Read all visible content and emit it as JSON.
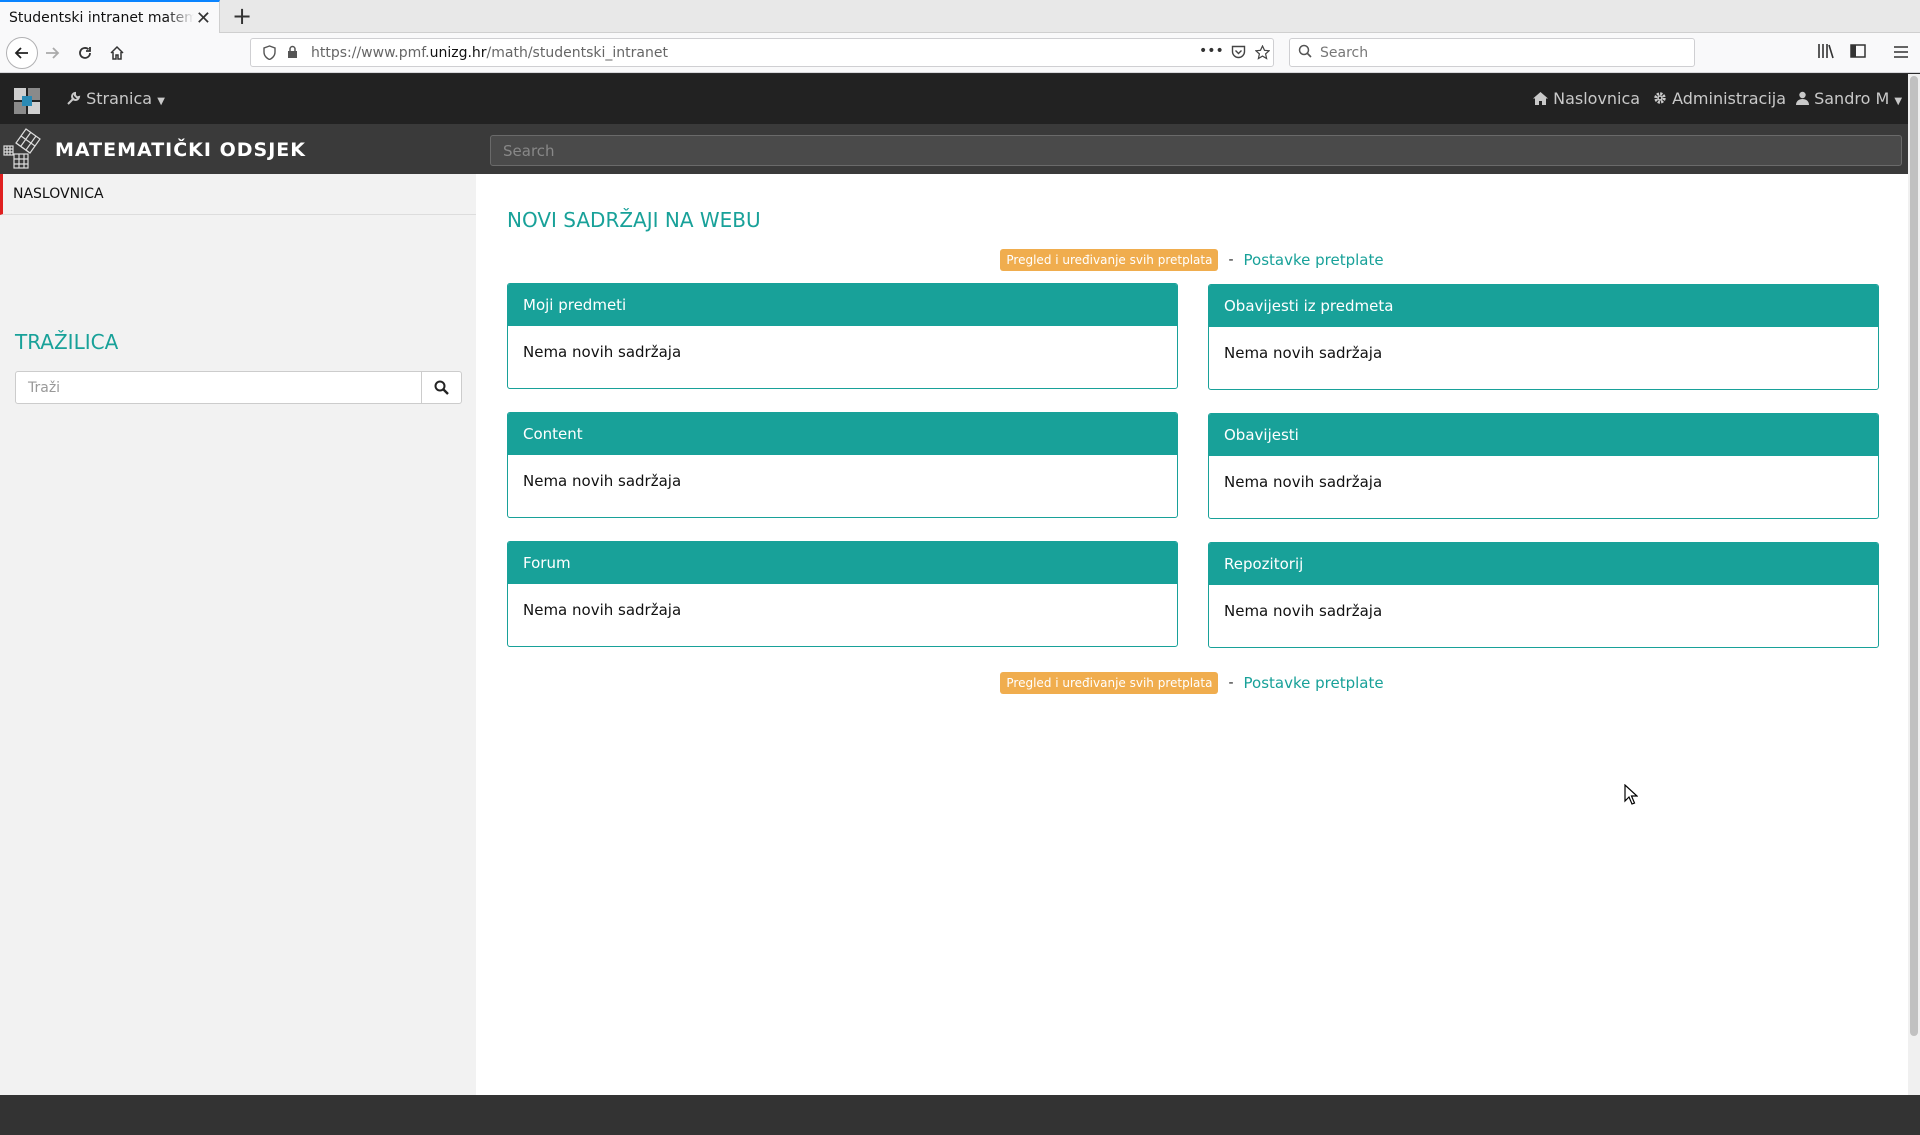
{
  "browser": {
    "tab_title": "Studentski intranet matematič",
    "tab_close": "✕",
    "new_tab": "+",
    "url_prefix": "https://www.pmf.",
    "url_domain": "unizg.hr",
    "url_path": "/math/studentski_intranet",
    "more_dots": "•••",
    "search_placeholder": "Search"
  },
  "topnav": {
    "stranica_label": "Stranica",
    "naslovnica_label": "Naslovnica",
    "administracija_label": "Administracija",
    "user_label": "Sandro M"
  },
  "header": {
    "brand": "MATEMATIČKI ODSJEK",
    "search_placeholder": "Search"
  },
  "sidebar": {
    "home_label": "NASLOVNICA",
    "search_heading": "TRAŽILICA",
    "search_placeholder": "Traži"
  },
  "main": {
    "title": "NOVI SADRŽAJI NA WEBU",
    "review_label": "Pregled i uređivanje svih pretplata",
    "dash": "-",
    "settings_link": "Postavke pretplate",
    "panels": [
      {
        "title": "Moji predmeti",
        "body": "Nema novih sadržaja"
      },
      {
        "title": "Obavijesti iz predmeta",
        "body": "Nema novih sadržaja"
      },
      {
        "title": "Content",
        "body": "Nema novih sadržaja"
      },
      {
        "title": "Obavijesti",
        "body": "Nema novih sadržaja"
      },
      {
        "title": "Forum",
        "body": "Nema novih sadržaja"
      },
      {
        "title": "Repozitorij",
        "body": "Nema novih sadržaja"
      }
    ]
  },
  "colors": {
    "accent": "#18a199",
    "badge": "#f0ad4e",
    "active_marker": "#e02020"
  }
}
